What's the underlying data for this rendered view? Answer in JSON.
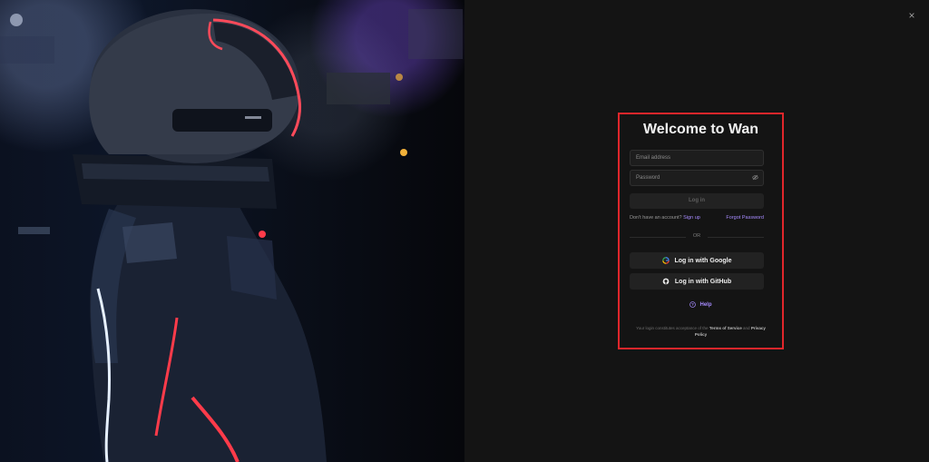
{
  "window": {
    "close_label": "×"
  },
  "login": {
    "title": "Welcome to Wan",
    "email_placeholder": "Email address",
    "password_placeholder": "Password",
    "login_button": "Log in",
    "no_account_text": "Don't have an account?",
    "signup_link": "Sign up",
    "forgot_password": "Forgot Password",
    "or_text": "OR",
    "google_button": "Log in with Google",
    "github_button": "Log in with GitHub",
    "help_label": "Help",
    "terms_prefix": "Your login constitutes acceptance of the",
    "terms_link": "Terms of Service",
    "terms_and": "and",
    "privacy_link": "Privacy Policy"
  },
  "colors": {
    "background": "#141414",
    "highlight_border": "#e1262b",
    "link": "#a78bff"
  }
}
